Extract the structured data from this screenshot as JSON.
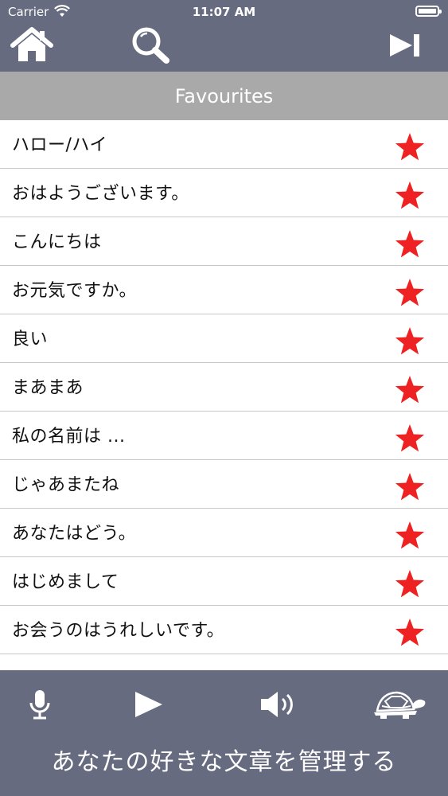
{
  "status_bar": {
    "carrier": "Carrier",
    "time": "11:07 AM"
  },
  "toolbar": {
    "icons": [
      "home-icon",
      "search-icon",
      "skip-next-icon"
    ]
  },
  "header": {
    "title": "Favourites"
  },
  "favourites": [
    {
      "text": "ハロー/ハイ"
    },
    {
      "text": "おはようございます。"
    },
    {
      "text": "こんにちは"
    },
    {
      "text": "お元気ですか。"
    },
    {
      "text": "良い"
    },
    {
      "text": "まあまあ"
    },
    {
      "text": "私の名前は ..."
    },
    {
      "text": "じゃあまたね"
    },
    {
      "text": "あなたはどう。"
    },
    {
      "text": "はじめまして"
    },
    {
      "text": "お会うのはうれしいです。"
    }
  ],
  "bottom_bar": {
    "icons": [
      "microphone-icon",
      "play-icon",
      "speaker-icon",
      "turtle-icon"
    ],
    "caption": "あなたの好きな文章を管理する"
  },
  "colors": {
    "bar": "#676b7f",
    "header": "#a9a9a9",
    "star": "#ee2222"
  }
}
